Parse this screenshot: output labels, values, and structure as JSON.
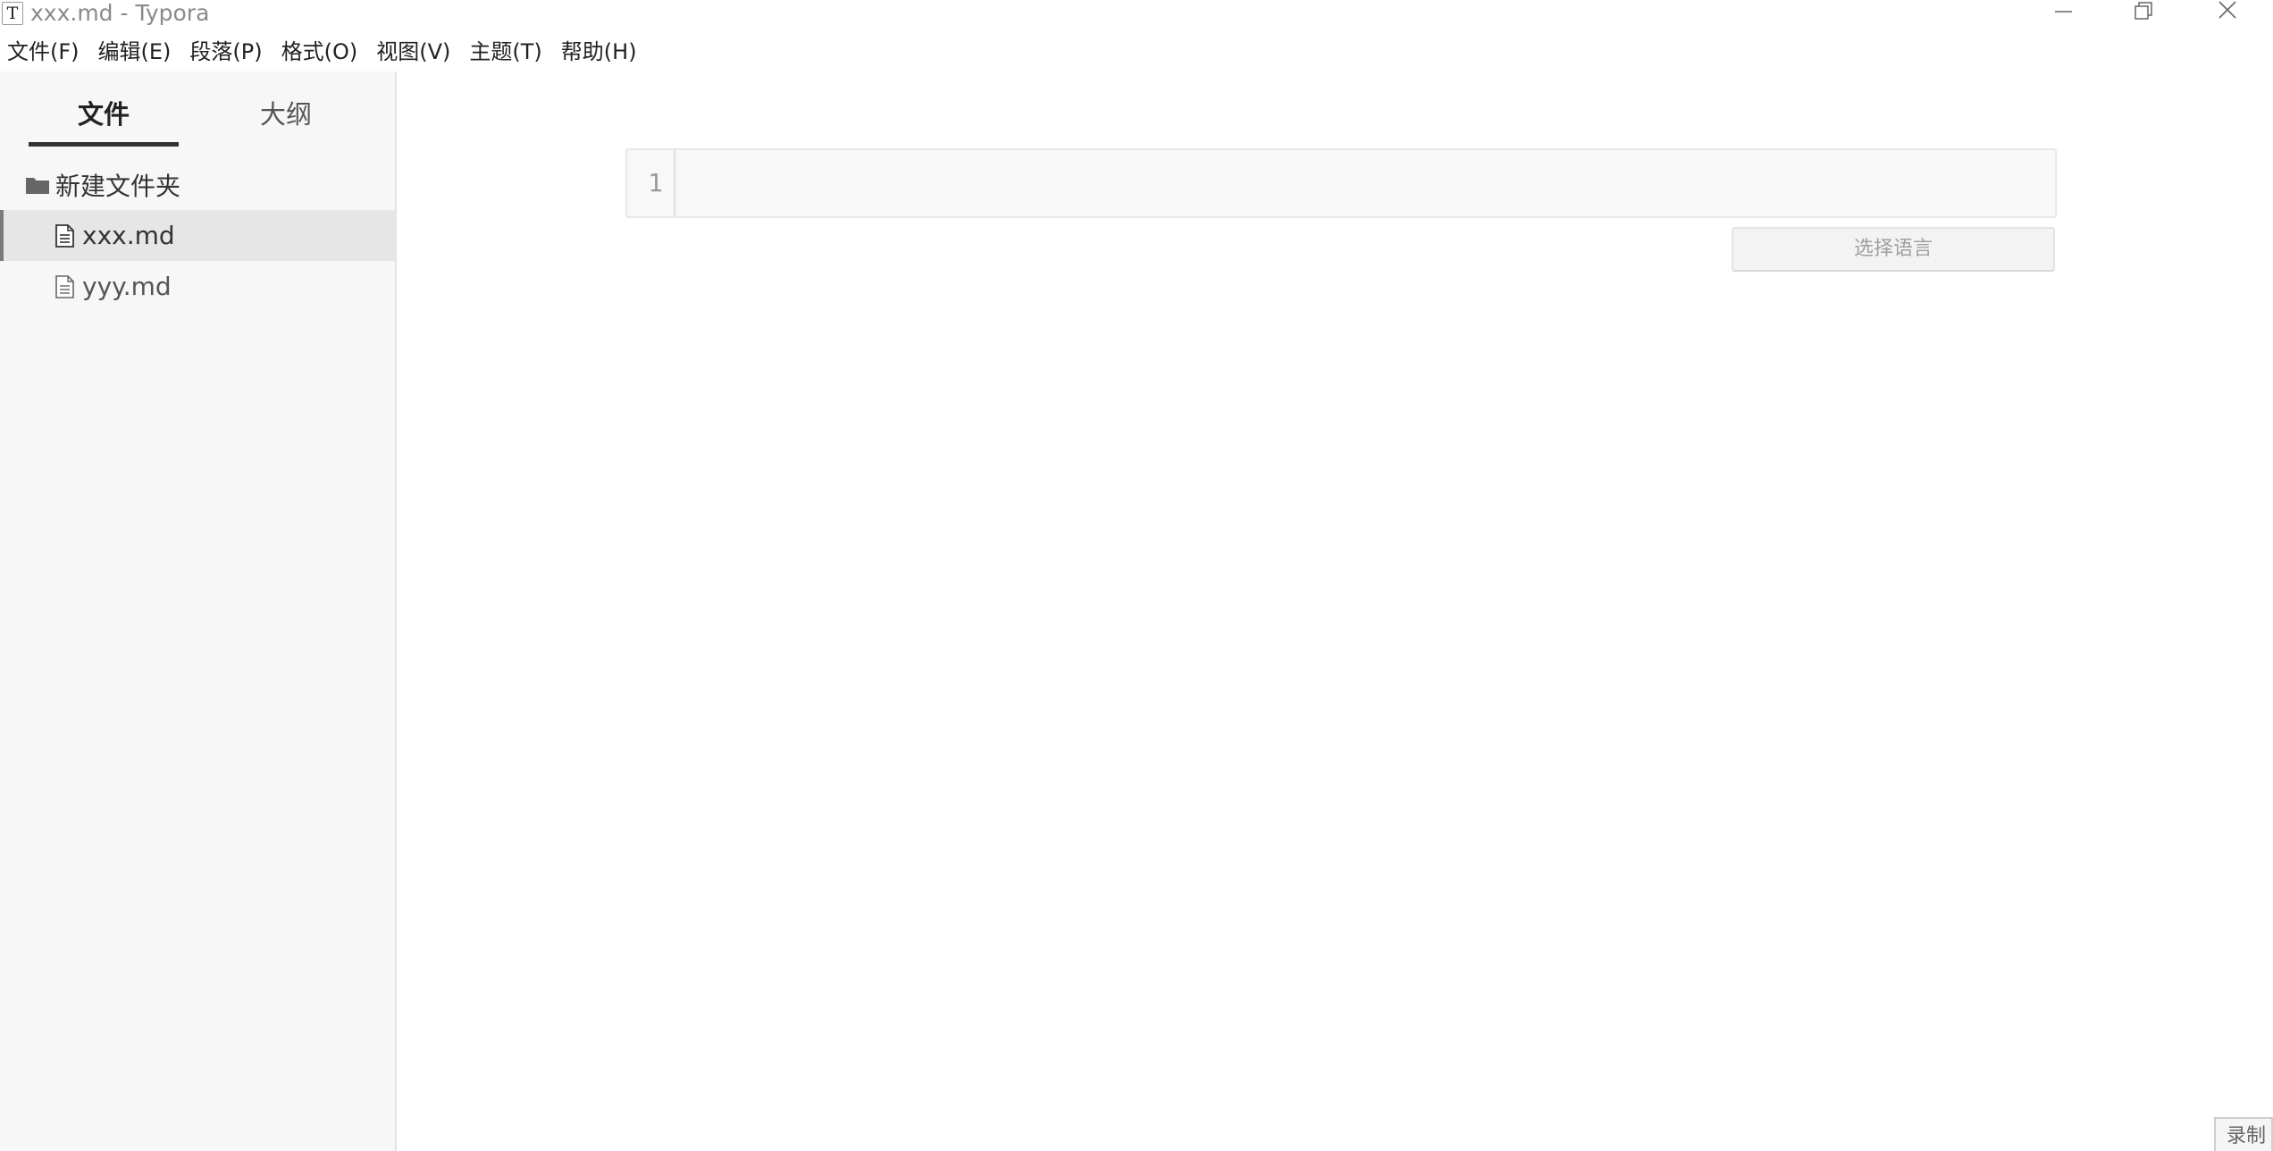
{
  "window": {
    "app_icon_glyph": "T",
    "title": "xxx.md - Typora",
    "controls": [
      "minimize-icon",
      "maximize-icon",
      "close-icon"
    ]
  },
  "menu": [
    {
      "label": "文件(F)"
    },
    {
      "label": "编辑(E)"
    },
    {
      "label": "段落(P)"
    },
    {
      "label": "格式(O)"
    },
    {
      "label": "视图(V)"
    },
    {
      "label": "主题(T)"
    },
    {
      "label": "帮助(H)"
    }
  ],
  "sidebar": {
    "tabs": [
      {
        "label": "文件",
        "active": true
      },
      {
        "label": "大纲",
        "active": false
      }
    ],
    "tree": {
      "folder": {
        "label": "新建文件夹",
        "icon": "folder-icon"
      },
      "files": [
        {
          "label": "xxx.md",
          "icon": "file-icon",
          "active": true
        },
        {
          "label": "yyy.md",
          "icon": "file-icon",
          "active": false
        }
      ]
    }
  },
  "editor": {
    "code_block": {
      "line_number": "1",
      "content": ""
    },
    "language_select": {
      "placeholder": "选择语言"
    }
  },
  "corner_tab": {
    "label": "录制"
  },
  "colors": {
    "sidebar_bg": "#f7f7f7",
    "active_row_bg": "#e6e6e6",
    "tab_underline": "#333333",
    "code_bg": "#f8f8f8"
  }
}
